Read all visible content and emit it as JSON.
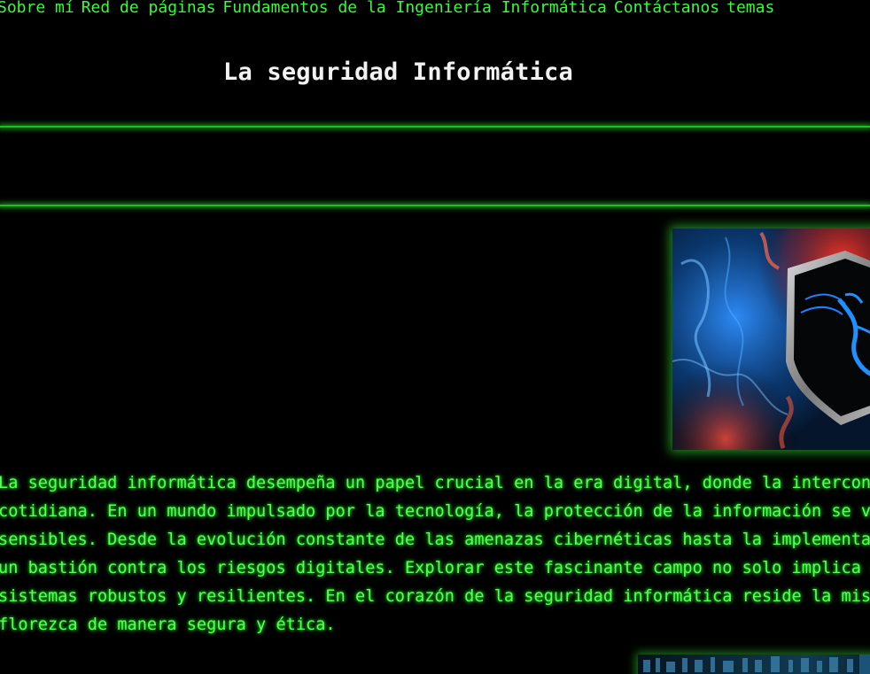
{
  "nav": {
    "items": [
      {
        "label": "Sobre mí"
      },
      {
        "label": "Red de páginas"
      },
      {
        "label": "Fundamentos de la Ingeniería Informática"
      },
      {
        "label": "Contáctanos"
      },
      {
        "label": "temas"
      }
    ]
  },
  "header": {
    "title": "La seguridad Informática"
  },
  "hero_image": {
    "subject": "shield with blue dragon emblem over colorful smoke"
  },
  "article": {
    "lines": [
      "La seguridad informática desempeña un papel crucial en la era digital, donde la interconex",
      "cotidiana. En un mundo impulsado por la tecnología, la protección de la información se vue",
      "sensibles. Desde la evolución constante de las amenazas cibernéticas hasta la implementaci",
      "un bastión contra los riesgos digitales. Explorar este fascinante campo no solo implica co",
      "sistemas robustos y resilientes. En el corazón de la seguridad informática reside la misió",
      "florezca de manera segura y ética."
    ]
  },
  "bottom_image": {
    "subject": "blue digital code background"
  },
  "colors": {
    "background": "#000000",
    "accent_green": "#33ff33",
    "title_white": "#f2f2f2"
  }
}
